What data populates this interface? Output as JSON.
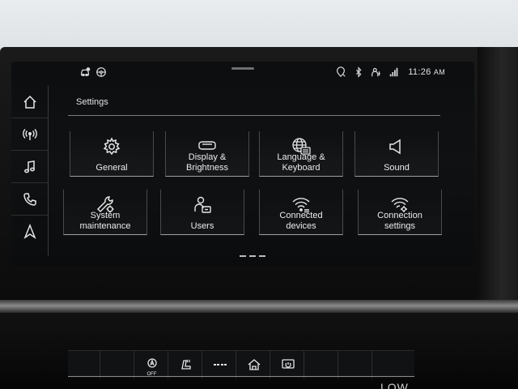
{
  "status_bar": {
    "time": "11:26",
    "time_suffix": "AM",
    "left_icons": [
      "vehicle-status-icon",
      "steering-wheel-icon"
    ],
    "right_icons": [
      "location-privacy-icon",
      "bluetooth-icon",
      "user-profile-icon",
      "signal-icon"
    ]
  },
  "side_nav": {
    "items": [
      {
        "icon": "home-icon"
      },
      {
        "icon": "radio-icon"
      },
      {
        "icon": "music-icon"
      },
      {
        "icon": "phone-icon"
      },
      {
        "icon": "navigation-icon"
      }
    ]
  },
  "page": {
    "title": "Settings"
  },
  "tiles": [
    {
      "label": "General",
      "icon": "gear-icon"
    },
    {
      "label": "Display &\nBrightness",
      "icon": "display-icon"
    },
    {
      "label": "Language &\nKeyboard",
      "icon": "globe-keyboard-icon"
    },
    {
      "label": "Sound",
      "icon": "speaker-icon"
    },
    {
      "label": "System\nmaintenance",
      "icon": "wrench-icon"
    },
    {
      "label": "Users",
      "icon": "user-icon"
    },
    {
      "label": "Connected\ndevices",
      "icon": "wifi-devices-icon"
    },
    {
      "label": "Connection\nsettings",
      "icon": "wifi-settings-icon"
    }
  ],
  "bottom_bar": {
    "buttons": [
      {
        "icon": "blank"
      },
      {
        "icon": "blank"
      },
      {
        "icon": "auto-off-icon",
        "label": "OFF"
      },
      {
        "icon": "seat-heat-icon"
      },
      {
        "icon": "menu-dots-icon"
      },
      {
        "icon": "home-car-icon"
      },
      {
        "icon": "power-icon"
      },
      {
        "icon": "blank"
      },
      {
        "icon": "blank"
      },
      {
        "icon": "blank"
      }
    ]
  },
  "lower_text": "LOW"
}
